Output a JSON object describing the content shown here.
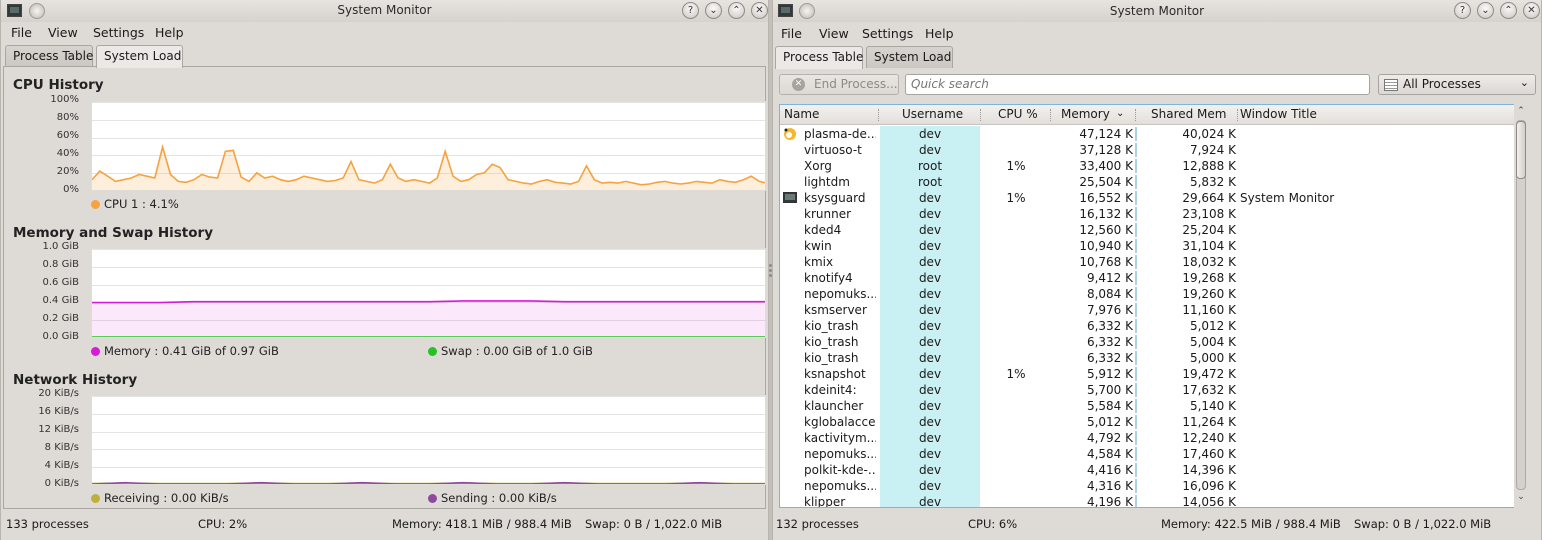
{
  "left_window": {
    "title": "System Monitor",
    "menu": [
      "File",
      "View",
      "Settings",
      "Help"
    ],
    "tabs": [
      "Process Table",
      "System Load"
    ],
    "active_tab": "System Load",
    "cpu_section": {
      "title": "CPU History",
      "y_ticks": [
        "100%",
        "80%",
        "60%",
        "40%",
        "20%",
        "0%"
      ],
      "legend": "CPU 1 : 4.1%",
      "color": "#f7a23e"
    },
    "memory_section": {
      "title": "Memory and Swap History",
      "y_ticks": [
        "1.0 GiB",
        "0.8 GiB",
        "0.6 GiB",
        "0.4 GiB",
        "0.2 GiB",
        "0.0 GiB"
      ],
      "legend_memory": "Memory : 0.41 GiB of 0.97 GiB",
      "legend_swap": "Swap : 0.00 GiB of 1.0 GiB",
      "memory_color": "#d81ad8",
      "swap_color": "#22c322"
    },
    "network_section": {
      "title": "Network History",
      "y_ticks": [
        "20 KiB/s",
        "16 KiB/s",
        "12 KiB/s",
        "8 KiB/s",
        "4 KiB/s",
        "0 KiB/s"
      ],
      "legend_receiving": "Receiving : 0.00 KiB/s",
      "legend_sending": "Sending : 0.00 KiB/s",
      "receiving_color": "#c2ae3a",
      "sending_color": "#8e4a9d"
    },
    "status": {
      "processes": "133 processes",
      "cpu": "CPU: 2%",
      "memory": "Memory: 418.1 MiB / 988.4 MiB",
      "swap": "Swap: 0 B / 1,022.0 MiB"
    }
  },
  "right_window": {
    "title": "System Monitor",
    "menu": [
      "File",
      "View",
      "Settings",
      "Help"
    ],
    "tabs": [
      "Process Table",
      "System Load"
    ],
    "active_tab": "Process Table",
    "end_process_label": "End Process...",
    "search_placeholder": "Quick search",
    "filter_value": "All Processes",
    "columns": [
      "Name",
      "Username",
      "CPU %",
      "Memory",
      "Shared Mem",
      "Window Title"
    ],
    "sort_column": "Memory",
    "rows": [
      {
        "name": "plasma-de...",
        "user": "dev",
        "cpu": "",
        "memory": "47,124 K",
        "shared": "40,024 K",
        "title": "",
        "icon": "plasma-icon"
      },
      {
        "name": "virtuoso-t",
        "user": "dev",
        "cpu": "",
        "memory": "37,128 K",
        "shared": "7,924 K",
        "title": "",
        "icon": ""
      },
      {
        "name": "Xorg",
        "user": "root",
        "cpu": "1%",
        "memory": "33,400 K",
        "shared": "12,888 K",
        "title": "",
        "icon": ""
      },
      {
        "name": "lightdm",
        "user": "root",
        "cpu": "",
        "memory": "25,504 K",
        "shared": "5,832 K",
        "title": "",
        "icon": ""
      },
      {
        "name": "ksysguard",
        "user": "dev",
        "cpu": "1%",
        "memory": "16,552 K",
        "shared": "29,664 K",
        "title": "System Monitor",
        "icon": "monitor-icon"
      },
      {
        "name": "krunner",
        "user": "dev",
        "cpu": "",
        "memory": "16,132 K",
        "shared": "23,108 K",
        "title": "",
        "icon": ""
      },
      {
        "name": "kded4",
        "user": "dev",
        "cpu": "",
        "memory": "12,560 K",
        "shared": "25,204 K",
        "title": "",
        "icon": ""
      },
      {
        "name": "kwin",
        "user": "dev",
        "cpu": "",
        "memory": "10,940 K",
        "shared": "31,104 K",
        "title": "",
        "icon": ""
      },
      {
        "name": "kmix",
        "user": "dev",
        "cpu": "",
        "memory": "10,768 K",
        "shared": "18,032 K",
        "title": "",
        "icon": ""
      },
      {
        "name": "knotify4",
        "user": "dev",
        "cpu": "",
        "memory": "9,412 K",
        "shared": "19,268 K",
        "title": "",
        "icon": ""
      },
      {
        "name": "nepomuks...",
        "user": "dev",
        "cpu": "",
        "memory": "8,084 K",
        "shared": "19,260 K",
        "title": "",
        "icon": ""
      },
      {
        "name": "ksmserver",
        "user": "dev",
        "cpu": "",
        "memory": "7,976 K",
        "shared": "11,160 K",
        "title": "",
        "icon": ""
      },
      {
        "name": "kio_trash",
        "user": "dev",
        "cpu": "",
        "memory": "6,332 K",
        "shared": "5,012 K",
        "title": "",
        "icon": ""
      },
      {
        "name": "kio_trash",
        "user": "dev",
        "cpu": "",
        "memory": "6,332 K",
        "shared": "5,004 K",
        "title": "",
        "icon": ""
      },
      {
        "name": "kio_trash",
        "user": "dev",
        "cpu": "",
        "memory": "6,332 K",
        "shared": "5,000 K",
        "title": "",
        "icon": ""
      },
      {
        "name": "ksnapshot",
        "user": "dev",
        "cpu": "1%",
        "memory": "5,912 K",
        "shared": "19,472 K",
        "title": "",
        "icon": ""
      },
      {
        "name": "kdeinit4:",
        "user": "dev",
        "cpu": "",
        "memory": "5,700 K",
        "shared": "17,632 K",
        "title": "",
        "icon": ""
      },
      {
        "name": "klauncher",
        "user": "dev",
        "cpu": "",
        "memory": "5,584 K",
        "shared": "5,140 K",
        "title": "",
        "icon": ""
      },
      {
        "name": "kglobalaccel",
        "user": "dev",
        "cpu": "",
        "memory": "5,012 K",
        "shared": "11,264 K",
        "title": "",
        "icon": ""
      },
      {
        "name": "kactivitym...",
        "user": "dev",
        "cpu": "",
        "memory": "4,792 K",
        "shared": "12,240 K",
        "title": "",
        "icon": ""
      },
      {
        "name": "nepomuks...",
        "user": "dev",
        "cpu": "",
        "memory": "4,584 K",
        "shared": "17,460 K",
        "title": "",
        "icon": ""
      },
      {
        "name": "polkit-kde-...",
        "user": "dev",
        "cpu": "",
        "memory": "4,416 K",
        "shared": "14,396 K",
        "title": "",
        "icon": ""
      },
      {
        "name": "nepomuks...",
        "user": "dev",
        "cpu": "",
        "memory": "4,316 K",
        "shared": "16,096 K",
        "title": "",
        "icon": ""
      },
      {
        "name": "klipper",
        "user": "dev",
        "cpu": "",
        "memory": "4,196 K",
        "shared": "14,056 K",
        "title": "",
        "icon": ""
      }
    ],
    "status": {
      "processes": "132 processes",
      "cpu": "CPU: 6%",
      "memory": "Memory: 422.5 MiB / 988.4 MiB",
      "swap": "Swap: 0 B / 1,022.0 MiB"
    }
  },
  "chart_data": [
    {
      "type": "line",
      "title": "CPU History",
      "ylim": [
        0,
        100
      ],
      "series": [
        {
          "name": "CPU 1",
          "values": [
            12,
            22,
            16,
            10,
            12,
            14,
            18,
            16,
            14,
            50,
            18,
            10,
            9,
            12,
            18,
            15,
            14,
            45,
            46,
            15,
            10,
            20,
            14,
            16,
            12,
            10,
            12,
            16,
            14,
            12,
            10,
            11,
            14,
            33,
            12,
            10,
            8,
            12,
            30,
            14,
            10,
            12,
            10,
            8,
            14,
            45,
            16,
            10,
            12,
            18,
            20,
            30,
            26,
            12,
            10,
            8,
            7,
            10,
            12,
            9,
            8,
            7,
            10,
            28,
            12,
            8,
            9,
            8,
            10,
            8,
            6,
            7,
            9,
            10,
            8,
            7,
            8,
            10,
            9,
            8,
            12,
            10,
            9,
            12,
            16,
            10,
            8
          ]
        }
      ]
    },
    {
      "type": "line",
      "title": "Memory and Swap History",
      "ylim": [
        0,
        1.0
      ],
      "series": [
        {
          "name": "Memory",
          "values": [
            0.4,
            0.4,
            0.4,
            0.41,
            0.41,
            0.41,
            0.41,
            0.41,
            0.41,
            0.41,
            0.41,
            0.42,
            0.42,
            0.42,
            0.41,
            0.41,
            0.41,
            0.41,
            0.41,
            0.41,
            0.41
          ]
        },
        {
          "name": "Swap",
          "values": [
            0,
            0,
            0,
            0,
            0,
            0,
            0,
            0,
            0,
            0,
            0,
            0,
            0,
            0,
            0,
            0,
            0,
            0,
            0,
            0,
            0
          ]
        }
      ]
    },
    {
      "type": "line",
      "title": "Network History",
      "ylim": [
        0,
        20
      ],
      "series": [
        {
          "name": "Receiving",
          "values": [
            0.1,
            0.2,
            0.1,
            0.1,
            0.1,
            0.2,
            0.1,
            0.1,
            0.2,
            0.1,
            0.1,
            0.2,
            0.1,
            0.1,
            0.2,
            0.1,
            0.1,
            0.1,
            0.2,
            0.1,
            0.1
          ]
        },
        {
          "name": "Sending",
          "values": [
            0,
            0.3,
            0,
            0,
            0,
            0.3,
            0,
            0,
            0.3,
            0,
            0,
            0.3,
            0,
            0,
            0.3,
            0,
            0,
            0,
            0.3,
            0,
            0
          ]
        }
      ]
    }
  ]
}
